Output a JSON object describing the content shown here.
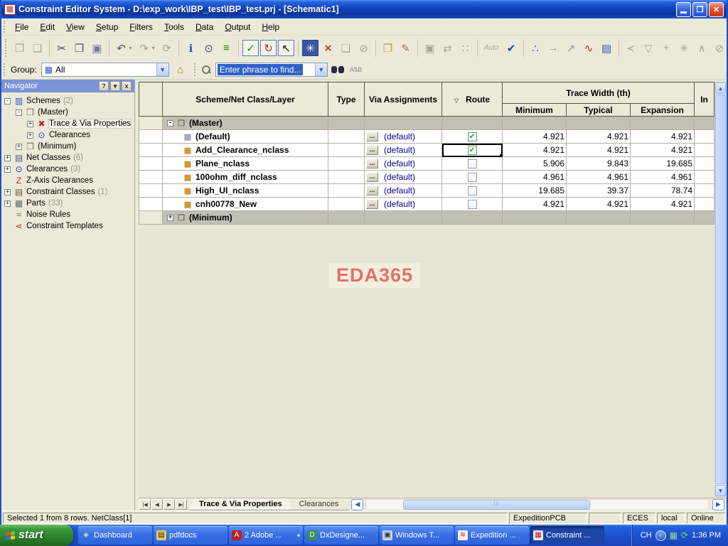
{
  "window": {
    "icon_glyph": "▦",
    "title": "Constraint Editor System - D:\\exp_work\\IBP_test\\IBP_test.prj - [Schematic1]",
    "close_glyph": "✕",
    "restore_glyph": "❐"
  },
  "menu": [
    "File",
    "Edit",
    "View",
    "Setup",
    "Filters",
    "Tools",
    "Data",
    "Output",
    "Help"
  ],
  "toolbar": {
    "groups": [
      [
        {
          "name": "open-button",
          "glyph": "❐",
          "color": "#a8a494"
        },
        {
          "name": "save-button",
          "glyph": "❏",
          "color": "#a8a494"
        }
      ],
      [
        {
          "name": "cut-button",
          "glyph": "✂",
          "color": "#445"
        },
        {
          "name": "copy-button",
          "glyph": "❐",
          "color": "#557"
        },
        {
          "name": "paste-button",
          "glyph": "▣",
          "color": "#779"
        }
      ],
      [
        {
          "name": "undo-button",
          "glyph": "↶",
          "color": "#456",
          "caret": true
        },
        {
          "name": "redo-button",
          "glyph": "↷",
          "color": "#a8a494",
          "caret": true
        },
        {
          "name": "sync-button",
          "glyph": "⟳",
          "color": "#a8a494"
        }
      ],
      [
        {
          "name": "info-button",
          "glyph": "ℹ",
          "color": "#2255cc"
        },
        {
          "name": "preview-button",
          "glyph": "⊙",
          "color": "#446"
        },
        {
          "name": "layers-button",
          "glyph": "≡",
          "color": "#1a8a1a"
        }
      ],
      [
        {
          "name": "display-control-button",
          "glyph": "✓",
          "color": "#1a8a1a",
          "boxed": true
        },
        {
          "name": "update-button",
          "glyph": "↻",
          "color": "#cc2222",
          "boxed": true
        },
        {
          "name": "select-mode-button",
          "glyph": "↖",
          "color": "#111",
          "boxed": true
        }
      ],
      [
        {
          "name": "freeze-button",
          "glyph": "✳",
          "color": "#ffffff",
          "bg": true
        },
        {
          "name": "delete-button",
          "glyph": "✕",
          "color": "#cc2222"
        },
        {
          "name": "stamp-button",
          "glyph": "❏",
          "color": "#a8a494"
        },
        {
          "name": "erase-button",
          "glyph": "⊘",
          "color": "#a8a494"
        }
      ],
      [
        {
          "name": "import-button",
          "glyph": "❐",
          "color": "#c09a30"
        },
        {
          "name": "brush-button",
          "glyph": "✎",
          "color": "#997755"
        }
      ],
      [
        {
          "name": "capture-button",
          "glyph": "▣",
          "color": "#a8a494"
        },
        {
          "name": "swap-button",
          "glyph": "⇄",
          "color": "#a8a494"
        },
        {
          "name": "spacing-button",
          "glyph": "∷",
          "color": "#a8a494"
        }
      ],
      [
        {
          "name": "auto-button",
          "glyph": "Auto",
          "color": "#a8a494",
          "text": true
        },
        {
          "name": "cad-check-button",
          "glyph": "✔",
          "color": "#2244aa"
        }
      ],
      [
        {
          "name": "topology-button",
          "glyph": "∴",
          "color": "#3366cc"
        },
        {
          "name": "net-order-button",
          "glyph": "→",
          "color": "#8899aa"
        },
        {
          "name": "diff-pair-button",
          "glyph": "↗",
          "color": "#8899aa"
        },
        {
          "name": "noise-button",
          "glyph": "∿",
          "color": "#cc2222"
        },
        {
          "name": "stackup-button",
          "glyph": "▤",
          "color": "#3355bb"
        }
      ],
      [
        {
          "name": "pin-pair-button",
          "glyph": "≺",
          "color": "#a8a494"
        },
        {
          "name": "route-edit-button",
          "glyph": "▽",
          "color": "#a8a494"
        },
        {
          "name": "add-pin-button",
          "glyph": "+",
          "color": "#a8a494"
        },
        {
          "name": "star-topology-button",
          "glyph": "✳",
          "color": "#a8a494"
        },
        {
          "name": "tree-topology-button",
          "glyph": "∧",
          "color": "#a8a494"
        },
        {
          "name": "probe1-button",
          "glyph": "⊘",
          "color": "#a8a494"
        },
        {
          "name": "probe2-button",
          "glyph": "⊘",
          "color": "#a8a494"
        }
      ]
    ]
  },
  "group_bar": {
    "label": "Group:",
    "value": "All",
    "home_glyph": "⌂",
    "search_value": "Enter phrase to find...",
    "ab_glyph": "A⇅B"
  },
  "navigator": {
    "title": "Navigator",
    "help_glyph": "?",
    "toggle_glyph": "▾",
    "close_glyph": "x",
    "items": [
      {
        "label": "Schemes",
        "count": "(2)",
        "level": 0,
        "expander": "minus",
        "icon": "schemes-icon",
        "glyph": "▥",
        "color": "#3355cc"
      },
      {
        "label": "(Master)",
        "count": "",
        "level": 1,
        "expander": "minus",
        "icon": "scheme-icon",
        "glyph": "❒",
        "color": "#776f5f"
      },
      {
        "label": "Trace & Via Properties",
        "count": "",
        "level": 2,
        "expander": "plus",
        "icon": "trace-via-icon",
        "glyph": "✖",
        "color": "#cc2233",
        "selected": true
      },
      {
        "label": "Clearances",
        "count": "",
        "level": 2,
        "expander": "plus",
        "icon": "clearances-icon",
        "glyph": "⊙",
        "color": "#2233cc"
      },
      {
        "label": "(Minimum)",
        "count": "",
        "level": 1,
        "expander": "plus",
        "icon": "scheme-icon",
        "glyph": "❒",
        "color": "#776f5f"
      },
      {
        "label": "Net Classes",
        "count": "(6)",
        "level": 0,
        "expander": "plus",
        "icon": "net-classes-icon",
        "glyph": "▤",
        "color": "#445588"
      },
      {
        "label": "Clearances",
        "count": "(3)",
        "level": 0,
        "expander": "plus",
        "icon": "clearances-icon",
        "glyph": "⊙",
        "color": "#2233cc"
      },
      {
        "label": "Z-Axis Clearances",
        "count": "",
        "level": 0,
        "expander": "none",
        "icon": "z-axis-icon",
        "glyph": "Z",
        "color": "#cc2222"
      },
      {
        "label": "Constraint Classes",
        "count": "(1)",
        "level": 0,
        "expander": "plus",
        "icon": "constraint-classes-icon",
        "glyph": "▤",
        "color": "#665544"
      },
      {
        "label": "Parts",
        "count": "(33)",
        "level": 0,
        "expander": "plus",
        "icon": "parts-icon",
        "glyph": "▦",
        "color": "#667"
      },
      {
        "label": "Noise Rules",
        "count": "",
        "level": 0,
        "expander": "none",
        "icon": "noise-rules-icon",
        "glyph": "≈",
        "color": "#1a8a1a"
      },
      {
        "label": "Constraint Templates",
        "count": "",
        "level": 0,
        "expander": "none",
        "icon": "templates-icon",
        "glyph": "⋖",
        "color": "#cc3333"
      }
    ]
  },
  "table": {
    "headers": {
      "name": "Scheme/Net Class/Layer",
      "type": "Type",
      "via": "Via Assignments",
      "route": "Route",
      "funnel_glyph": "▽",
      "trace_width": "Trace Width (th)",
      "min": "Minimum",
      "typ": "Typical",
      "exp": "Expansion",
      "in_col": "In"
    },
    "rows": [
      {
        "kind": "group",
        "name": "(Master)",
        "expander": "minus",
        "icon_glyph": "❒",
        "icon_color": "#776f5f"
      },
      {
        "kind": "net",
        "name": "(Default)",
        "icon_glyph": "▤",
        "icon_color": "#7a8db0",
        "dots": "...",
        "via": "(default)",
        "route": true,
        "min": "4.921",
        "typ": "4.921",
        "exp": "4.921"
      },
      {
        "kind": "net",
        "name": "Add_Clearance_nclass",
        "icon_glyph": "▦",
        "icon_color": "#c89020",
        "dots": "...",
        "via": "(default)",
        "route": true,
        "active": true,
        "min": "4.921",
        "typ": "4.921",
        "exp": "4.921"
      },
      {
        "kind": "net",
        "name": "Plane_nclass",
        "icon_glyph": "▦",
        "icon_color": "#c89020",
        "dots": "...",
        "via": "(default)",
        "route": false,
        "min": "5.906",
        "typ": "9.843",
        "exp": "19.685"
      },
      {
        "kind": "net",
        "name": "100ohm_diff_nclass",
        "icon_glyph": "▦",
        "icon_color": "#c89020",
        "dots": "...",
        "via": "(default)",
        "route": false,
        "min": "4.961",
        "typ": "4.961",
        "exp": "4.961"
      },
      {
        "kind": "net",
        "name": "High_UI_nclass",
        "icon_glyph": "▦",
        "icon_color": "#c89020",
        "dots": "...",
        "via": "(default)",
        "route": false,
        "min": "19.685",
        "typ": "39.37",
        "exp": "78.74"
      },
      {
        "kind": "net",
        "name": "cnh00778_New",
        "icon_glyph": "▦",
        "icon_color": "#c89020",
        "dots": "...",
        "via": "(default)",
        "route": false,
        "min": "4.921",
        "typ": "4.921",
        "exp": "4.921"
      },
      {
        "kind": "group",
        "name": "(Minimum)",
        "expander": "plus",
        "icon_glyph": "❒",
        "icon_color": "#776f5f"
      }
    ]
  },
  "watermark": "EDA365",
  "tabs": {
    "nav": [
      "|◀",
      "◀",
      "▶",
      "▶|"
    ],
    "items": [
      {
        "label": "Trace & Via Properties",
        "active": true
      },
      {
        "label": "Clearances",
        "active": false
      }
    ],
    "scroll_left_glyph": "◀",
    "scroll_right_glyph": "▶"
  },
  "status_bar": {
    "selection": "Selected 1 from 8 rows. NetClass[1]",
    "flow": "ExpeditionPCB",
    "spare": "",
    "app": "ECES",
    "mode": "local",
    "state": "Online"
  },
  "taskbar": {
    "start": "start",
    "tasks": [
      {
        "label": "Dashboard",
        "icon": "dashboard-icon",
        "glyph": "◈",
        "fg": "#bfe8bf",
        "bg": "transparent"
      },
      {
        "label": "pdfdocs",
        "icon": "folder-icon",
        "glyph": "▤",
        "fg": "#3a2a10",
        "bg": "#e8c860"
      },
      {
        "label": "2 Adobe ...",
        "icon": "acrobat-icon",
        "glyph": "A",
        "fg": "#ffffff",
        "bg": "#c22020",
        "dropdown": "▾"
      },
      {
        "label": "DxDesigne...",
        "icon": "dxdesigner-icon",
        "glyph": "D",
        "fg": "#ffffff",
        "bg": "#3a8a5a"
      },
      {
        "label": "Windows T...",
        "icon": "computer-icon",
        "glyph": "▣",
        "fg": "#223355",
        "bg": "#c8d4e8"
      },
      {
        "label": "Expedition ...",
        "icon": "expedition-icon",
        "glyph": "≋",
        "fg": "#c22020",
        "bg": "#f4f4f4"
      },
      {
        "label": "Constraint ...",
        "icon": "ces-icon",
        "glyph": "▦",
        "fg": "#b02020",
        "bg": "#f0e0e0",
        "active": true
      }
    ],
    "tray": {
      "lang": "CH",
      "chevron_glyph": "‹",
      "net_glyph": "▦",
      "refresh_glyph": "⟳",
      "time": "1:36 PM"
    }
  }
}
